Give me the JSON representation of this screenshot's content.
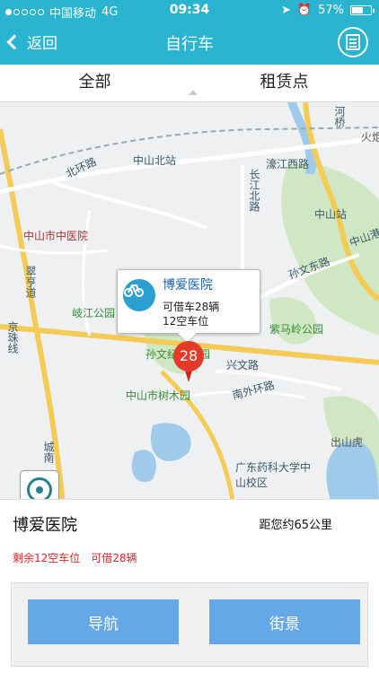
{
  "status_bar": {
    "carrier": "中国移动",
    "network": "4G",
    "time": "09:34",
    "battery": "57%"
  },
  "nav": {
    "back_label": "返回",
    "title": "自行车",
    "list_icon": "list-doc-icon"
  },
  "tabs": [
    {
      "label": "全部"
    },
    {
      "label": "租赁点"
    }
  ],
  "map": {
    "labels": {
      "shiliuzhan": "中山北站",
      "beihuan": "北环路",
      "zhongyiyuan": "中山市中医院",
      "cuihengdao": "翠亨道",
      "qijiang": "岐江公园",
      "jingzhu": "京珠线",
      "sunwen": "孙文纪念公园",
      "sunwendong": "孙文东路",
      "zimaling": "紫马岭公园",
      "xingwen": "兴文路",
      "shumu": "中山市树木园",
      "nanwai": "南外环路",
      "guangdong": "广东药科大学中山校区",
      "chushan": "出山虎",
      "changjiang": "长江北路",
      "haojiang": "濠江西路",
      "zhongshanzhan": "中山站",
      "zhongshangang": "中山港大",
      "hekou": "河桥",
      "huoju": "火炬",
      "chengnan": "城南"
    },
    "callout": {
      "name": "博爱医院",
      "bikes_available": "可借车28辆",
      "empty_slots": "12空车位"
    },
    "pin": {
      "count": "28"
    },
    "colors": {
      "pin": "#e33a2a",
      "callout_icon": "#2b9fcf"
    }
  },
  "panel": {
    "name": "博爱医院",
    "distance": "距您约65公里",
    "slots": "剩余12空车位",
    "bikes": "可借28辆",
    "navigate_label": "导航",
    "streetview_label": "街景"
  }
}
